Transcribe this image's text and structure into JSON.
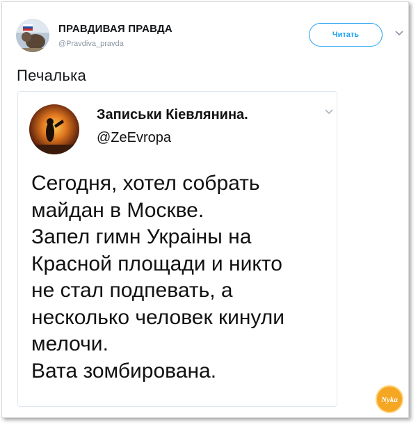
{
  "tweet": {
    "author_name": "ПРАВДИВАЯ ПРАВДА",
    "author_handle": "@Pravdiva_pravda",
    "follow_label": "Читать",
    "text": "Печалька"
  },
  "quoted_tweet": {
    "author_name": "Записьки Кіевлянина.",
    "author_handle": "@ZeEvropa",
    "body_lines": [
      "Сегодня, хотел собрать",
      "майдан в Москве.",
      "Запел гимн Украіны на",
      "Красной площади и никто",
      "не стал подпевать, а",
      "несколько человек кинули",
      "мелочи.",
      "Вата зомбирована."
    ]
  },
  "watermark": {
    "text": "Nyka"
  },
  "colors": {
    "accent": "#1da1f2",
    "handle_gray": "#8a96a3",
    "border": "#e1e8ed",
    "watermark_orange": "#f5a623"
  }
}
